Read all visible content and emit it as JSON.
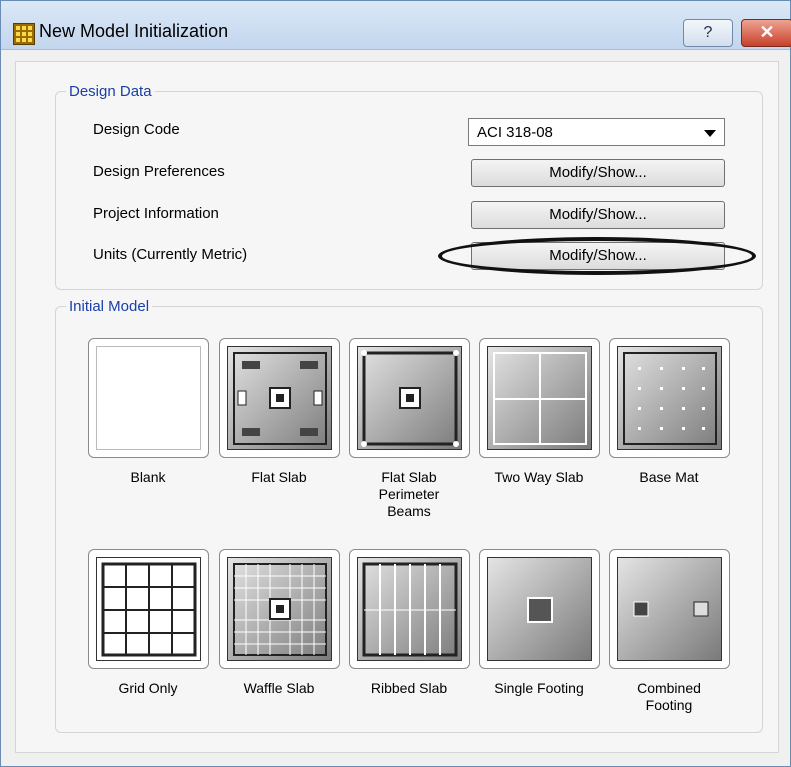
{
  "window": {
    "title": "New Model Initialization",
    "help_glyph": "?",
    "close_glyph": "✕"
  },
  "design_data": {
    "legend": "Design Data",
    "design_code_label": "Design Code",
    "design_code_value": "ACI 318-08",
    "design_preferences_label": "Design Preferences",
    "design_preferences_button": "Modify/Show...",
    "project_information_label": "Project Information",
    "project_information_button": "Modify/Show...",
    "units_label": "Units  (Currently Metric)",
    "units_button": "Modify/Show..."
  },
  "initial_model": {
    "legend": "Initial Model",
    "options": [
      {
        "label": "Blank",
        "icon": "blank-icon"
      },
      {
        "label": "Flat Slab",
        "icon": "flat-slab-icon"
      },
      {
        "label_lines": [
          "Flat Slab",
          "Perimeter",
          "Beams"
        ],
        "icon": "flat-slab-perimeter-beams-icon"
      },
      {
        "label": "Two Way Slab",
        "icon": "two-way-slab-icon"
      },
      {
        "label": "Base Mat",
        "icon": "base-mat-icon"
      },
      {
        "label": "Grid Only",
        "icon": "grid-only-icon"
      },
      {
        "label": "Waffle Slab",
        "icon": "waffle-slab-icon"
      },
      {
        "label": "Ribbed Slab",
        "icon": "ribbed-slab-icon"
      },
      {
        "label": "Single Footing",
        "icon": "single-footing-icon"
      },
      {
        "label_lines": [
          "Combined",
          "Footing"
        ],
        "icon": "combined-footing-icon"
      }
    ]
  },
  "colors": {
    "legend_text": "#1a3ea8",
    "close_button": "#c7412a",
    "title_bar": "#c3d6ee"
  }
}
